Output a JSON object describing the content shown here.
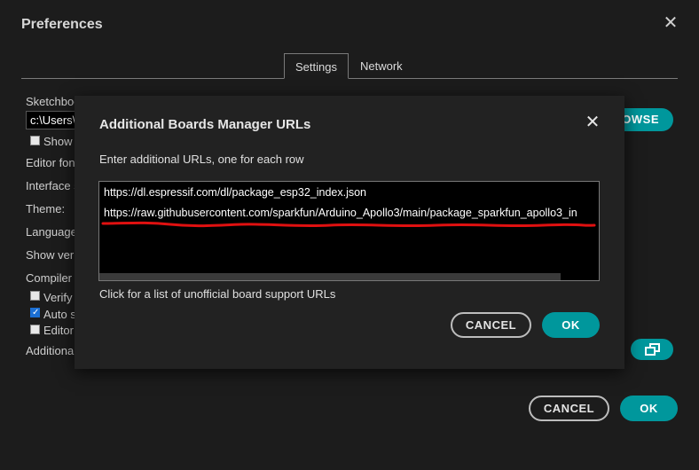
{
  "window": {
    "title": "Preferences"
  },
  "tabs": [
    {
      "label": "Settings",
      "active": true
    },
    {
      "label": "Network",
      "active": false
    }
  ],
  "settings": {
    "sketchbook_label": "Sketchbook location:",
    "sketchbook_value": "c:\\Users\\",
    "show_label": "Show",
    "editor_font_label": "Editor fon",
    "interface_label": "Interface s",
    "theme_label": "Theme:",
    "language_label": "Language",
    "show_verbose_label": "Show verb",
    "compiler_label": "Compiler",
    "verify_label": "Verify",
    "auto_label": "Auto s",
    "editor_label": "Editor",
    "additional_label": "Additiona",
    "browse_label": "OWSE"
  },
  "dialog": {
    "title": "Additional Boards Manager URLs",
    "subtitle": "Enter additional URLs, one for each row",
    "urls": [
      "https://dl.espressif.com/dl/package_esp32_index.json",
      "https://raw.githubusercontent.com/sparkfun/Arduino_Apollo3/main/package_sparkfun_apollo3_in"
    ],
    "link": "Click for a list of unofficial board support URLs",
    "cancel_label": "CANCEL",
    "ok_label": "OK"
  },
  "footer": {
    "cancel_label": "CANCEL",
    "ok_label": "OK"
  },
  "colors": {
    "accent": "#00979c",
    "annotation": "#e01010",
    "background": "#1c1c1c"
  },
  "icons": {
    "close": "close-icon",
    "open_window": "open-window-icon"
  }
}
